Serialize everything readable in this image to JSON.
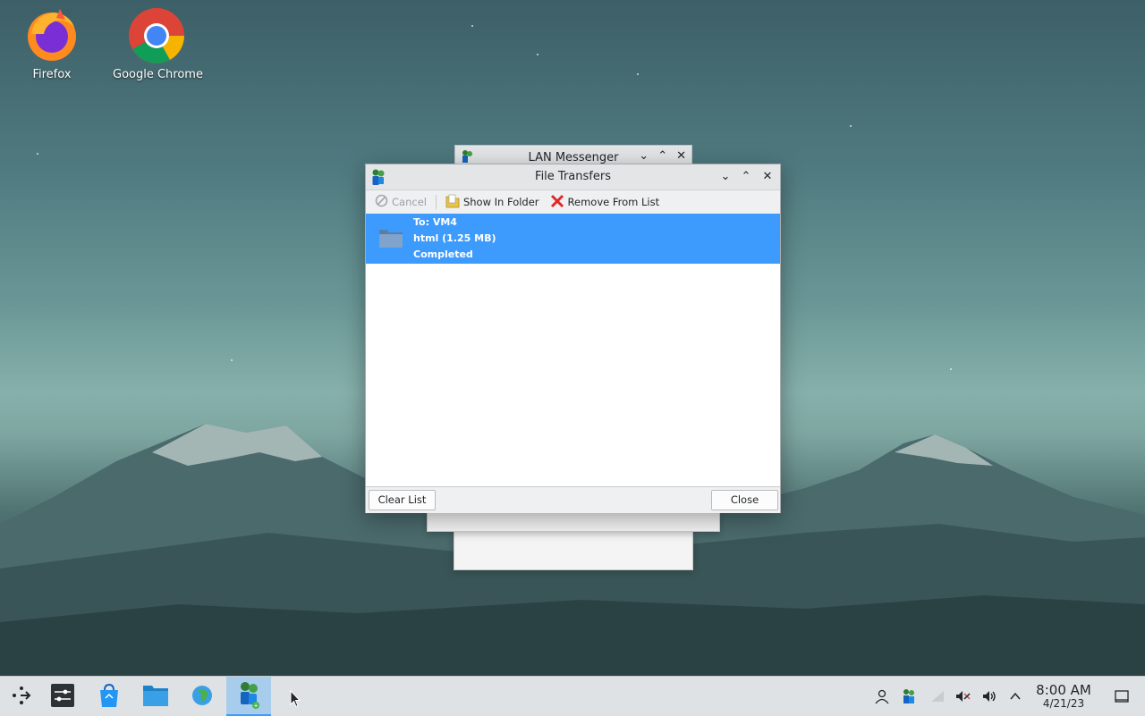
{
  "desktop": {
    "icons": [
      {
        "label": "Firefox"
      },
      {
        "label": "Google Chrome"
      }
    ]
  },
  "background_window": {
    "title": "LAN Messenger"
  },
  "dialog": {
    "title": "File Transfers",
    "toolbar": {
      "cancel": "Cancel",
      "show_in_folder": "Show In Folder",
      "remove_from_list": "Remove From List"
    },
    "transfers": [
      {
        "to": "To: VM4",
        "file": "html (1.25 MB)",
        "status": "Completed"
      }
    ],
    "footer": {
      "clear_list": "Clear List",
      "close": "Close"
    }
  },
  "taskbar": {
    "clock_time": "8:00 AM",
    "clock_date": "4/21/23"
  },
  "colors": {
    "selection": "#3d9bfd",
    "taskbar_bg": "#dfe2e5",
    "active_task": "#a8cdec"
  }
}
